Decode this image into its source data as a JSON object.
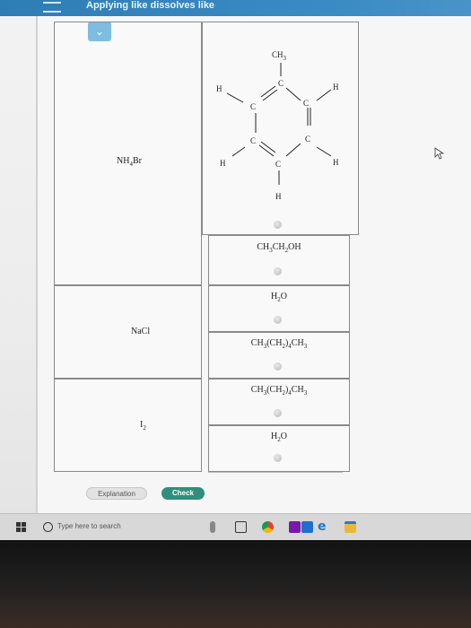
{
  "app": {
    "title": "Applying like dissolves like"
  },
  "table": {
    "rows": [
      {
        "ion": "NH",
        "ion_sub": "4",
        "ion_tail": "Br",
        "solvents": [
          {
            "kind": "structure",
            "name": "toluene"
          },
          {
            "kind": "text",
            "label": "CH3CH2OH"
          }
        ]
      },
      {
        "ion": "NaCl",
        "solvents": [
          {
            "kind": "text",
            "label": "H2O"
          },
          {
            "kind": "text",
            "label": "CH3(CH2)4CH3"
          }
        ]
      },
      {
        "ion": "I",
        "ion_sub": "2",
        "solvents": [
          {
            "kind": "text",
            "label": "CH3(CH2)4CH3"
          },
          {
            "kind": "text",
            "label": "H2O"
          }
        ]
      }
    ],
    "structure_atoms": {
      "methyl": "CH",
      "methyl_sub": "3",
      "c": "C",
      "h": "H"
    },
    "sub_digits": {
      "two": "2",
      "three": "3",
      "four": "4"
    }
  },
  "buttons": {
    "explanation": "Explanation",
    "check": "Check"
  },
  "taskbar": {
    "search_placeholder": "Type here to search"
  },
  "icons": [
    "menu-icon",
    "chevron-down-icon",
    "windows-icon",
    "search-icon",
    "task-view-icon",
    "chrome-icon",
    "onenote-icon",
    "edge-icon",
    "file-explorer-icon",
    "cursor-icon"
  ]
}
